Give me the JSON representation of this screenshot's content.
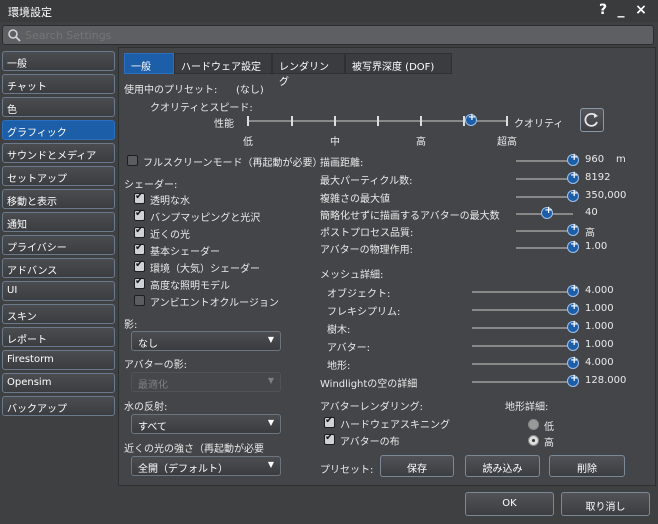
{
  "window": {
    "title": "環境設定",
    "help": "?",
    "minimize": "_",
    "close": "×"
  },
  "search": {
    "placeholder": "Search Settings"
  },
  "sidebar": {
    "items": [
      {
        "label": "一般"
      },
      {
        "label": "チャット"
      },
      {
        "label": "色"
      },
      {
        "label": "グラフィック",
        "active": true
      },
      {
        "label": "サウンドとメディア"
      },
      {
        "label": "セットアップ"
      },
      {
        "label": "移動と表示"
      },
      {
        "label": "通知"
      },
      {
        "label": "プライバシー"
      },
      {
        "label": "アドバンス"
      },
      {
        "label": "UI"
      },
      {
        "label": "スキン"
      },
      {
        "label": "レポート"
      },
      {
        "label": "Firestorm"
      },
      {
        "label": "Opensim"
      },
      {
        "label": "バックアップ"
      }
    ]
  },
  "tabs": [
    {
      "label": "一般",
      "active": true
    },
    {
      "label": "ハードウェア設定"
    },
    {
      "label": "レンダリング"
    },
    {
      "label": "被写界深度 (DOF)"
    }
  ],
  "preset": {
    "label": "使用中のプリセット:",
    "value": "(なし)"
  },
  "quality": {
    "title": "クオリティとスピード:",
    "left_label": "性能",
    "right_label": "クオリティ",
    "ticks": [
      "低",
      "中",
      "高",
      "超高"
    ],
    "level": 0.86
  },
  "fullscreen": {
    "label": "フルスクリーンモード（再起動が必要）",
    "checked": false
  },
  "shaders": {
    "title": "シェーダー:",
    "items": [
      {
        "label": "透明な水",
        "checked": true
      },
      {
        "label": "バンプマッピングと光沢",
        "checked": true
      },
      {
        "label": "近くの光",
        "checked": true
      },
      {
        "label": "基本シェーダー",
        "checked": true
      },
      {
        "label": "環境（大気）シェーダー",
        "checked": true
      },
      {
        "label": "高度な照明モデル",
        "checked": true
      },
      {
        "label": "アンビエントオクルージョン",
        "checked": false
      }
    ]
  },
  "shadows": {
    "label": "影:",
    "value": "なし"
  },
  "avatar_shadows": {
    "label": "アバターの影:",
    "value": "最適化"
  },
  "water": {
    "label": "水の反射:",
    "value": "すべて"
  },
  "nearby_light": {
    "label": "近くの光の強さ（再起動が必要",
    "value": "全開（デフォルト）"
  },
  "right_sliders": [
    {
      "label": "描画距離:",
      "value": "960",
      "unit": "m",
      "level": 1.0
    },
    {
      "label": "最大パーティクル数:",
      "value": "8192",
      "level": 1.0
    },
    {
      "label": "複雑さの最大値",
      "value": "350,000",
      "level": 1.0
    },
    {
      "label": "簡略化せずに描画するアバターの最大数",
      "value": "40",
      "level": 0.55
    },
    {
      "label": "ポストプロセス品質:",
      "value": "高",
      "level": 1.0
    },
    {
      "label": "アバターの物理作用:",
      "value": "1.00",
      "level": 1.0
    }
  ],
  "mesh": {
    "title": "メッシュ詳細:",
    "items": [
      {
        "label": "オブジェクト:",
        "value": "4.000",
        "level": 1.0
      },
      {
        "label": "フレキシプリム:",
        "value": "1.000",
        "level": 1.0
      },
      {
        "label": "樹木:",
        "value": "1.000",
        "level": 1.0
      },
      {
        "label": "アバター:",
        "value": "1.000",
        "level": 1.0
      },
      {
        "label": "地形:",
        "value": "4.000",
        "level": 1.0
      },
      {
        "label": "Windlightの空の詳細",
        "value": "128.000",
        "level": 1.0
      }
    ]
  },
  "avatar_render": {
    "title": "アバターレンダリング:",
    "items": [
      {
        "label": "ハードウェアスキニング",
        "checked": true
      },
      {
        "label": "アバターの布",
        "checked": true
      }
    ]
  },
  "terrain": {
    "title": "地形詳細:",
    "options": [
      {
        "label": "低",
        "selected": false
      },
      {
        "label": "高",
        "selected": true
      }
    ]
  },
  "presets": {
    "label": "プリセット:",
    "save": "保存",
    "load": "読み込み",
    "delete": "削除"
  },
  "footer": {
    "ok": "OK",
    "cancel": "取り消し"
  },
  "colors": {
    "accent": "#1d5ea8",
    "background": "#3f4042"
  }
}
